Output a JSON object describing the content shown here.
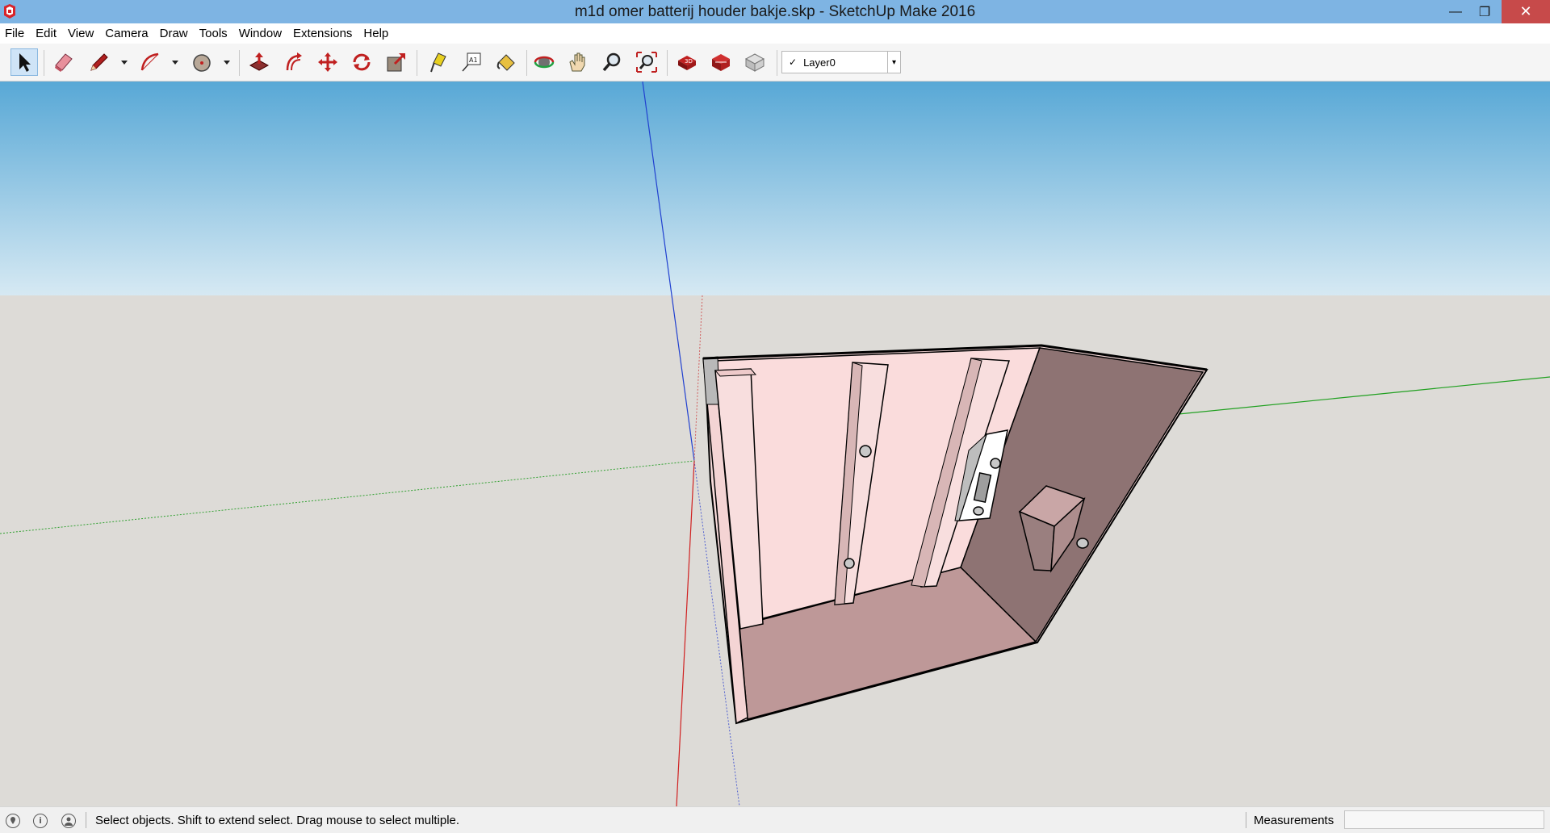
{
  "window": {
    "title": "m1d omer batterij houder bakje.skp - SketchUp Make 2016",
    "minimize_glyph": "—",
    "maximize_glyph": "❐",
    "close_glyph": "✕"
  },
  "menu": {
    "items": [
      "File",
      "Edit",
      "View",
      "Camera",
      "Draw",
      "Tools",
      "Window",
      "Extensions",
      "Help"
    ]
  },
  "toolbar": {
    "tools": [
      {
        "name": "select-tool",
        "icon": "arrow-cursor-icon"
      },
      {
        "name": "eraser-tool",
        "icon": "eraser-icon"
      },
      {
        "name": "line-tool",
        "icon": "pencil-icon"
      },
      {
        "name": "arc-tool",
        "icon": "arc-icon"
      },
      {
        "name": "shapes-tool",
        "icon": "circle-icon"
      },
      {
        "name": "push-pull-tool",
        "icon": "push-pull-icon"
      },
      {
        "name": "offset-tool",
        "icon": "offset-icon"
      },
      {
        "name": "move-tool",
        "icon": "move-icon"
      },
      {
        "name": "rotate-tool",
        "icon": "rotate-icon"
      },
      {
        "name": "scale-tool",
        "icon": "scale-icon"
      },
      {
        "name": "tape-measure-tool",
        "icon": "tape-measure-icon"
      },
      {
        "name": "text-tool",
        "icon": "text-icon"
      },
      {
        "name": "paint-bucket-tool",
        "icon": "paint-bucket-icon"
      },
      {
        "name": "orbit-tool",
        "icon": "orbit-icon"
      },
      {
        "name": "pan-tool",
        "icon": "hand-icon"
      },
      {
        "name": "zoom-tool",
        "icon": "magnifier-icon"
      },
      {
        "name": "zoom-extents-tool",
        "icon": "zoom-extents-icon"
      },
      {
        "name": "3d-warehouse",
        "icon": "warehouse-icon"
      },
      {
        "name": "extension-warehouse",
        "icon": "extension-warehouse-icon"
      },
      {
        "name": "share-model",
        "icon": "share-model-icon"
      }
    ],
    "layer_check": "✓",
    "layer_value": "Layer0",
    "layer_dropdown_glyph": "▾"
  },
  "status": {
    "message": "Select objects. Shift to extend select. Drag mouse to select multiple.",
    "geo_icon": "geo-location-icon",
    "info_icon_glyph": "i",
    "user_icon": "user-icon",
    "measurements_label": "Measurements",
    "measurements_value": ""
  },
  "colors": {
    "title_bar": "#7eb4e3",
    "close_button": "#c74a4a",
    "sky_top": "#58a8d6",
    "ground": "#dddbd7",
    "model_face_light": "#f9dfdf",
    "model_face_dark": "#8e7373",
    "model_floor": "#be9898",
    "axis_red": "#d02020",
    "axis_green": "#20a020",
    "axis_blue": "#2040d0"
  }
}
